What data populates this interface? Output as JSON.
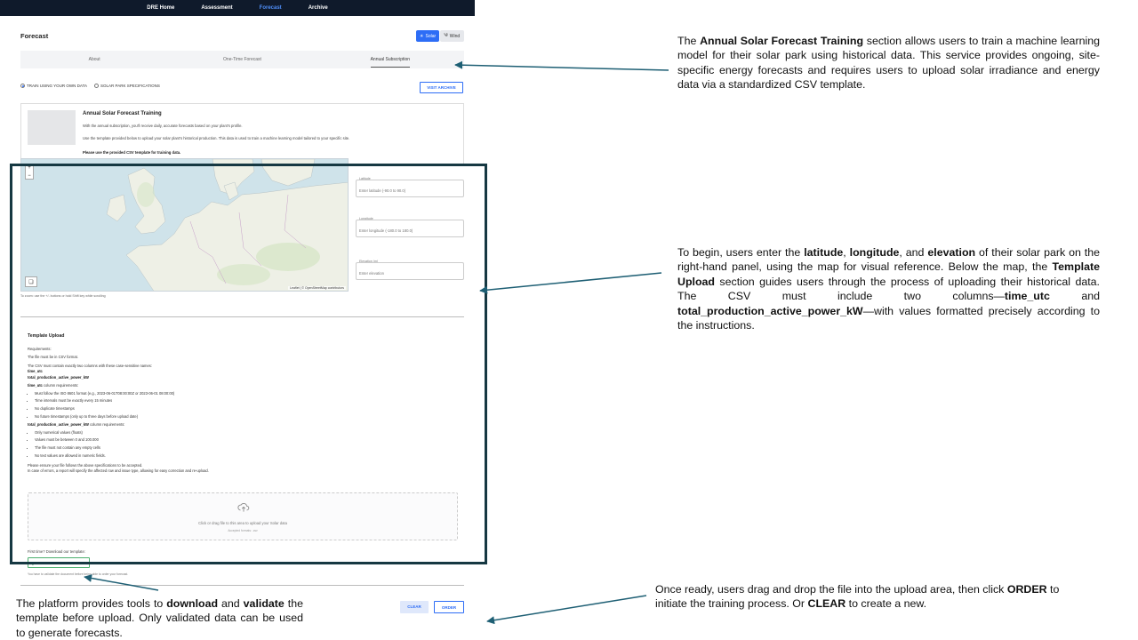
{
  "nav": {
    "items": [
      "DRE Home",
      "Assessment",
      "Forecast",
      "Archive"
    ],
    "active_index": 2
  },
  "header": {
    "title": "Forecast",
    "toggle_solar": "Solar",
    "toggle_wind": "Wind"
  },
  "tabs": [
    {
      "label": "About",
      "active": false
    },
    {
      "label": "One-Time Forecast",
      "active": false
    },
    {
      "label": "Annual Subscription",
      "active": true
    }
  ],
  "options": {
    "radio_own_data": "TRAIN USING YOUR OWN DATA",
    "radio_specs": "SOLAR PARK SPECIFICATIONS",
    "visit_archive": "VISIT ARCHIVE"
  },
  "info_card": {
    "title": "Annual Solar Forecast Training",
    "p1": "With the annual subscription, you'll receive daily, accurate forecasts based on your plant's profile.",
    "p2": "Use the template provided below to upload your solar plant's historical production. This data is used to train a machine learning model tailored to your specific site.",
    "p3": "Please use the provided CSV template for training data."
  },
  "map": {
    "zoom_in": "+",
    "zoom_out": "−",
    "attribution": "Leaflet | © OpenStreetMap contributors",
    "hint": "To zoom: use the +/- buttons or hold Shift key while scrolling"
  },
  "fields": {
    "latitude_label": "Latitude",
    "latitude_placeholder": "Enter latitude (-90.0 to 90.0)",
    "longitude_label": "Longitude",
    "longitude_placeholder": "Enter longitude (-180.0 to 180.0)",
    "elevation_label": "Elevation (m)",
    "elevation_placeholder": "Enter elevation"
  },
  "template_upload": {
    "title": "Template Upload",
    "requirements": "Requirements:",
    "csv_format": "The file must be in CSV format.",
    "columns_intro": "The CSV must contain exactly two columns with these case-sensitive names:",
    "col1": "time_utc",
    "col2": "total_production_active_power_kW",
    "col1_req": "column requirements:",
    "col1_bullets": [
      "Must follow the ISO 8601 format (e.g., 2023-06-01T08:00:00Z or 2023-06-01 08:00:00)",
      "Time intervals must be exactly every 15 minutes",
      "No duplicate timestamps",
      "No future timestamps (only up to three days before upload date)"
    ],
    "col2_req": "column requirements:",
    "col2_bullets": [
      "Only numerical values (floats)",
      "Values must be between 0 and 100.000",
      "The file must not contain any empty cells",
      "No text values are allowed in numeric fields."
    ],
    "ensure": "Please ensure your file follows the above specifications to be accepted.",
    "errors": "In case of errors, a report will specify the affected row and issue type, allowing for easy correction and re-upload.",
    "dropzone_text": "Click or drag file to this area to upload your Solar data",
    "dropzone_sub": "Accepted formats: .csv"
  },
  "download": {
    "first_time": "First time? Download our template:",
    "button": "DOWNLOAD TEMPLATE",
    "note": "You have to validate the document before being able to order your forecast."
  },
  "actions": {
    "clear": "CLEAR",
    "order": "ORDER"
  },
  "colors": {
    "nav_bg": "#0f1a2b",
    "accent": "#2d6df6",
    "highlight_border": "#163842",
    "arrow": "#1e5f74",
    "download_green": "#3f9b5e"
  }
}
